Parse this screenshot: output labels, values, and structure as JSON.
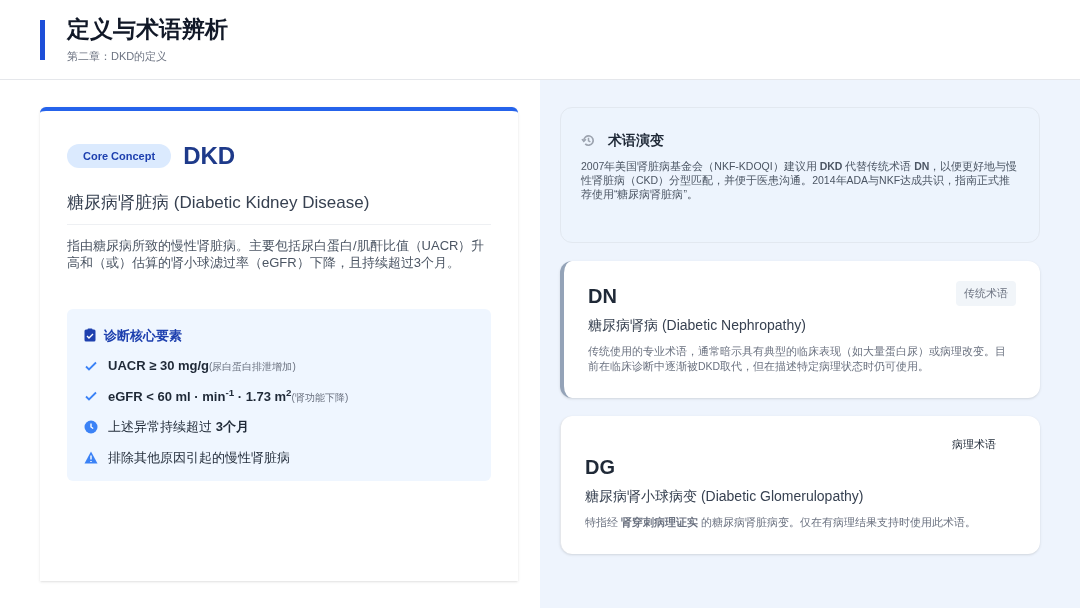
{
  "header": {
    "title": "定义与术语辨析",
    "subtitle": "第二章：DKD的定义"
  },
  "concept": {
    "badge": "Core Concept",
    "term": "DKD",
    "full_name": "糖尿病肾脏病 (Diabetic Kidney Disease)",
    "description": "指由糖尿病所致的慢性肾脏病。主要包括尿白蛋白/肌酐比值（UACR）升高和（或）估算的肾小球滤过率（eGFR）下降，且持续超过3个月。",
    "criteria": {
      "title": "诊断核心要素",
      "items": [
        {
          "kind": "check",
          "text": "**UACR ≥ 30 mg/g**",
          "note": "(尿白蛋白排泄增加)"
        },
        {
          "kind": "check",
          "text": "**eGFR < 60 ml · min$^{-1}$ · 1.73 m$^{2}$**",
          "note": "(肾功能下降)"
        },
        {
          "kind": "clock",
          "text": "上述异常持续超过 **3个月**"
        },
        {
          "kind": "warning",
          "text": "排除其他原因引起的慢性肾脏病"
        }
      ]
    }
  },
  "evolution": {
    "title": "术语演变",
    "text": "2007年美国肾脏病基金会（NKF-KDOQI）建议用 **DKD** 代替传统术语 **DN**，以便更好地与慢性肾脏病（CKD）分型匹配，并便于医患沟通。2014年ADA与NKF达成共识，指南正式推荐使用“糖尿病肾脏病”。"
  },
  "terms": [
    {
      "kind": "traditional",
      "abbr": "DN",
      "tag": "传统术语",
      "full_name": "糖尿病肾病 (Diabetic Nephropathy)",
      "text": "传统使用的专业术语，通常暗示具有典型的临床表现（如大量蛋白尿）或病理改变。目前在临床诊断中逐渐被DKD取代，但在描述特定病理状态时仍可使用。"
    },
    {
      "kind": "pathological",
      "abbr": "DG",
      "tag": "病理术语",
      "full_name": "糖尿病肾小球病变 (Diabetic Glomerulopathy)",
      "text": "特指经 **肾穿刺病理证实** 的糖尿病肾脏病变。仅在有病理结果支持时使用此术语。"
    }
  ]
}
